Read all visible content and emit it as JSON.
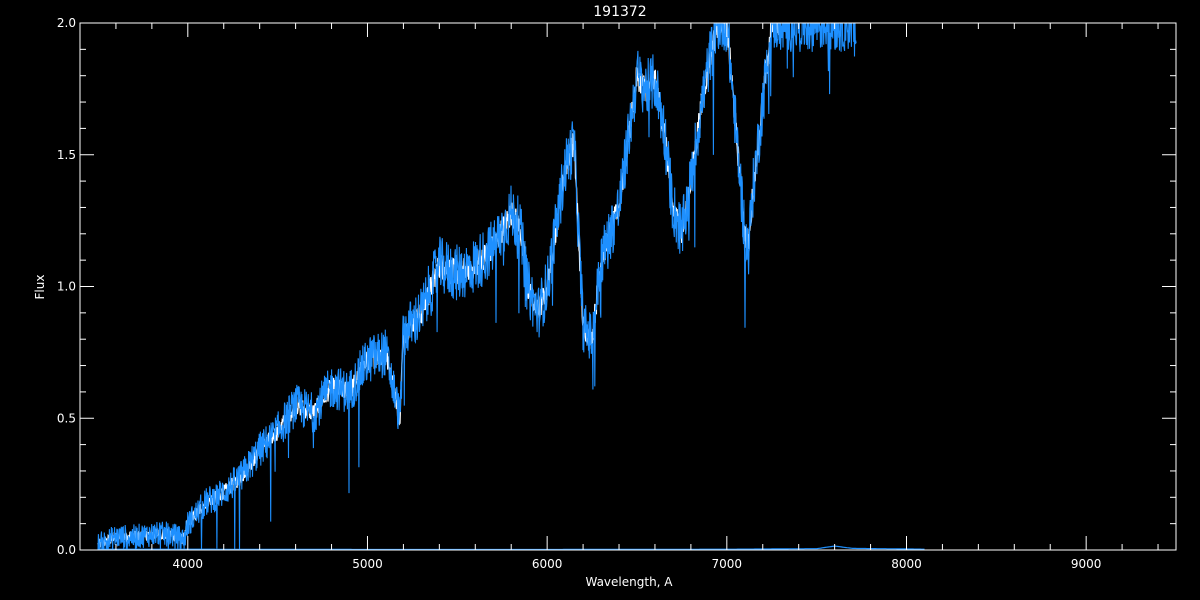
{
  "chart_data": {
    "type": "line",
    "title": "191372",
    "xlabel": "Wavelength, A",
    "ylabel": "Flux",
    "xlim": [
      3400,
      9500
    ],
    "ylim": [
      0,
      2.0
    ],
    "x_ticks": [
      4000,
      5000,
      6000,
      7000,
      8000,
      9000
    ],
    "x_tick_labels": [
      "4000",
      "5000",
      "6000",
      "7000",
      "8000",
      "9000"
    ],
    "y_ticks": [
      0,
      0.5,
      1.0,
      1.5,
      2.0
    ],
    "y_tick_labels": [
      "0.0",
      "0.5",
      "1.0",
      "1.5",
      "2.0"
    ],
    "background": "#000000",
    "axis_color": "#ffffff",
    "grid": false,
    "legend": "none",
    "series": [
      {
        "color": "#ffffff",
        "x": [
          3500,
          3600,
          3700,
          3800,
          3900,
          3980,
          4000,
          4100,
          4200,
          4300,
          4400,
          4500,
          4600,
          4700,
          4800,
          4900,
          5000,
          5100,
          5150,
          5180,
          5200,
          5300,
          5400,
          5500,
          5600,
          5700,
          5800,
          5850,
          5890,
          5950,
          6000,
          6100,
          6150,
          6200,
          6250,
          6300,
          6400,
          6450,
          6500,
          6550,
          6600,
          6650,
          6700,
          6750,
          6800,
          6850,
          6900,
          6950,
          7000,
          7050,
          7100,
          7120,
          7150,
          7200,
          7250,
          7300
        ],
        "y": [
          0.02,
          0.05,
          0.05,
          0.06,
          0.06,
          0.04,
          0.1,
          0.18,
          0.22,
          0.28,
          0.38,
          0.45,
          0.55,
          0.52,
          0.62,
          0.6,
          0.72,
          0.75,
          0.6,
          0.5,
          0.82,
          0.9,
          1.08,
          1.05,
          1.08,
          1.15,
          1.28,
          1.22,
          1.0,
          0.9,
          1.0,
          1.45,
          1.55,
          0.85,
          0.8,
          1.1,
          1.3,
          1.55,
          1.8,
          1.75,
          1.78,
          1.6,
          1.3,
          1.2,
          1.4,
          1.65,
          1.85,
          2.0,
          2.0,
          1.6,
          1.2,
          1.15,
          1.4,
          1.7,
          2.0,
          2.0
        ]
      },
      {
        "color": "#1e90ff",
        "x": [
          3500,
          3600,
          3700,
          3800,
          3900,
          3980,
          4000,
          4100,
          4200,
          4300,
          4400,
          4500,
          4600,
          4700,
          4800,
          4900,
          5000,
          5100,
          5150,
          5180,
          5200,
          5300,
          5400,
          5500,
          5600,
          5700,
          5800,
          5850,
          5890,
          5950,
          6000,
          6100,
          6150,
          6200,
          6250,
          6300,
          6400,
          6450,
          6500,
          6550,
          6600,
          6650,
          6700,
          6750,
          6800,
          6850,
          6900,
          6950,
          7000,
          7050,
          7100,
          7120,
          7150,
          7200,
          7250,
          7300,
          7500,
          7700,
          7720
        ],
        "y": [
          0.02,
          0.05,
          0.05,
          0.06,
          0.06,
          0.04,
          0.1,
          0.18,
          0.22,
          0.28,
          0.38,
          0.45,
          0.55,
          0.52,
          0.62,
          0.6,
          0.72,
          0.75,
          0.6,
          0.5,
          0.82,
          0.9,
          1.08,
          1.05,
          1.08,
          1.15,
          1.28,
          1.22,
          1.0,
          0.9,
          1.0,
          1.45,
          1.55,
          0.85,
          0.8,
          1.1,
          1.3,
          1.55,
          1.8,
          1.75,
          1.78,
          1.6,
          1.3,
          1.2,
          1.4,
          1.65,
          1.85,
          2.0,
          2.0,
          1.6,
          1.2,
          1.15,
          1.4,
          1.7,
          2.0,
          2.0,
          2.0,
          2.0,
          1.9
        ]
      },
      {
        "color": "#1e90ff",
        "x": [
          3500,
          4000,
          5000,
          6000,
          7000,
          7500,
          7600,
          7700,
          8000,
          8100
        ],
        "y": [
          0.003,
          0.003,
          0.002,
          0.002,
          0.003,
          0.005,
          0.015,
          0.006,
          0.004,
          0.003
        ]
      }
    ]
  }
}
